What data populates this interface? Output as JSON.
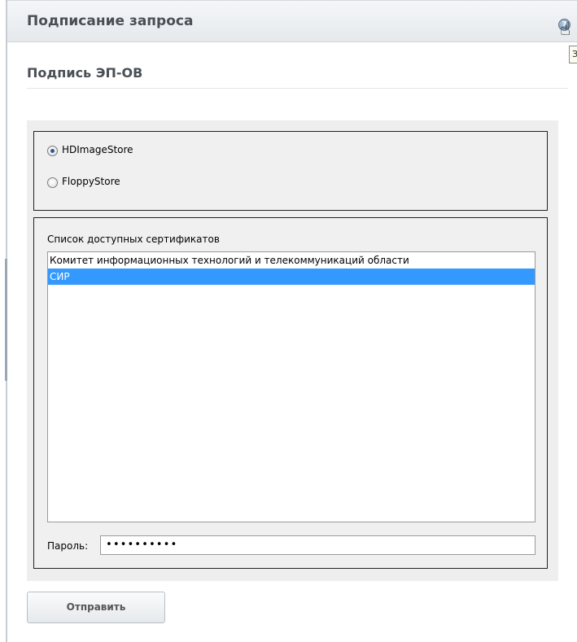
{
  "header": {
    "title": "Подписание запроса",
    "help_icon": "help-icon",
    "tooltip_fragment": "З"
  },
  "section": {
    "title": "Подпись ЭП-ОВ"
  },
  "store": {
    "options": [
      {
        "label": "HDImageStore",
        "selected": true
      },
      {
        "label": "FloppyStore",
        "selected": false
      }
    ]
  },
  "certificates": {
    "title": "Список доступных сертификатов",
    "items": [
      {
        "label": "Комитет информационных технологий и телекоммуникаций области",
        "selected": false
      },
      {
        "label": "СИР",
        "selected": true
      }
    ]
  },
  "password": {
    "label": "Пароль:",
    "value": "••••••••••"
  },
  "actions": {
    "send_label": "Отправить"
  },
  "colors": {
    "selection": "#3399ff",
    "header_bg": "#e6e9ec",
    "panel_bg": "#eeeeee"
  }
}
